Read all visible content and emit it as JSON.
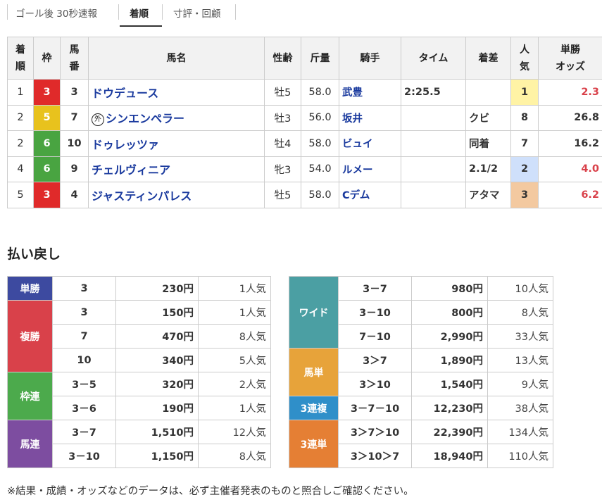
{
  "tabs": [
    {
      "label": "ゴール後 30秒速報"
    },
    {
      "label": "着順"
    },
    {
      "label": "寸評・回顧"
    }
  ],
  "results": {
    "headers": {
      "rank": [
        "着",
        "順"
      ],
      "waku": "枠",
      "umaban": [
        "馬",
        "番"
      ],
      "name": "馬名",
      "sexage": "性齢",
      "weight": "斤量",
      "jockey": "騎手",
      "time": "タイム",
      "margin": "着差",
      "pop": [
        "人",
        "気"
      ],
      "odds": [
        "単勝",
        "オッズ"
      ]
    },
    "rows": [
      {
        "rank": "1",
        "waku": "3",
        "umaban": "3",
        "name": "ドウデュース",
        "mark": "",
        "sexage": "牡5",
        "weight": "58.0",
        "jockey": "武豊",
        "time": "2:25.5",
        "margin": "",
        "pop": "1",
        "odds": "2.3"
      },
      {
        "rank": "2",
        "waku": "5",
        "umaban": "7",
        "name": "シンエンペラー",
        "mark": "外",
        "sexage": "牡3",
        "weight": "56.0",
        "jockey": "坂井",
        "time": "",
        "margin": "クビ",
        "pop": "8",
        "odds": "26.8"
      },
      {
        "rank": "2",
        "waku": "6",
        "umaban": "10",
        "name": "ドゥレッツァ",
        "mark": "",
        "sexage": "牡4",
        "weight": "58.0",
        "jockey": "ビュイ",
        "time": "",
        "margin": "同着",
        "pop": "7",
        "odds": "16.2"
      },
      {
        "rank": "4",
        "waku": "6",
        "umaban": "9",
        "name": "チェルヴィニア",
        "mark": "",
        "sexage": "牝3",
        "weight": "54.0",
        "jockey": "ルメー",
        "time": "",
        "margin": "2.1/2",
        "pop": "2",
        "odds": "4.0"
      },
      {
        "rank": "5",
        "waku": "3",
        "umaban": "4",
        "name": "ジャスティンパレス",
        "mark": "",
        "sexage": "牡5",
        "weight": "58.0",
        "jockey": "Cデム",
        "time": "",
        "margin": "アタマ",
        "pop": "3",
        "odds": "6.2"
      }
    ]
  },
  "payout": {
    "heading": "払い戻し",
    "left": {
      "tansho": {
        "label": "単勝",
        "rows": [
          {
            "num": "3",
            "yen": "230円",
            "ninki": "1人気"
          }
        ]
      },
      "fukusho": {
        "label": "複勝",
        "rows": [
          {
            "num": "3",
            "yen": "150円",
            "ninki": "1人気"
          },
          {
            "num": "7",
            "yen": "470円",
            "ninki": "8人気"
          },
          {
            "num": "10",
            "yen": "340円",
            "ninki": "5人気"
          }
        ]
      },
      "wakuren": {
        "label": "枠連",
        "rows": [
          {
            "num": "3－5",
            "yen": "320円",
            "ninki": "2人気"
          },
          {
            "num": "3－6",
            "yen": "190円",
            "ninki": "1人気"
          }
        ]
      },
      "umaren": {
        "label": "馬連",
        "rows": [
          {
            "num": "3－7",
            "yen": "1,510円",
            "ninki": "12人気"
          },
          {
            "num": "3－10",
            "yen": "1,150円",
            "ninki": "8人気"
          }
        ]
      }
    },
    "right": {
      "wide": {
        "label": "ワイド",
        "rows": [
          {
            "num": "3－7",
            "yen": "980円",
            "ninki": "10人気"
          },
          {
            "num": "3－10",
            "yen": "800円",
            "ninki": "8人気"
          },
          {
            "num": "7－10",
            "yen": "2,990円",
            "ninki": "33人気"
          }
        ]
      },
      "umatan": {
        "label": "馬単",
        "rows": [
          {
            "num": "3＞7",
            "yen": "1,890円",
            "ninki": "13人気"
          },
          {
            "num": "3＞10",
            "yen": "1,540円",
            "ninki": "9人気"
          }
        ]
      },
      "sanfuku": {
        "label": "3連複",
        "rows": [
          {
            "num": "3－7－10",
            "yen": "12,230円",
            "ninki": "38人気"
          }
        ]
      },
      "santan": {
        "label": "3連単",
        "rows": [
          {
            "num": "3＞7＞10",
            "yen": "22,390円",
            "ninki": "134人気"
          },
          {
            "num": "3＞10＞7",
            "yen": "18,940円",
            "ninki": "110人気"
          }
        ]
      }
    }
  },
  "note": "※結果・成績・オッズなどのデータは、必ず主催者発表のものと照合しご確認ください。",
  "colors": {
    "waku3": "#e02a2a",
    "waku5": "#e8c21d",
    "waku6": "#49a441",
    "link": "#1a3a9e",
    "odds_hot": "#d9414a"
  }
}
